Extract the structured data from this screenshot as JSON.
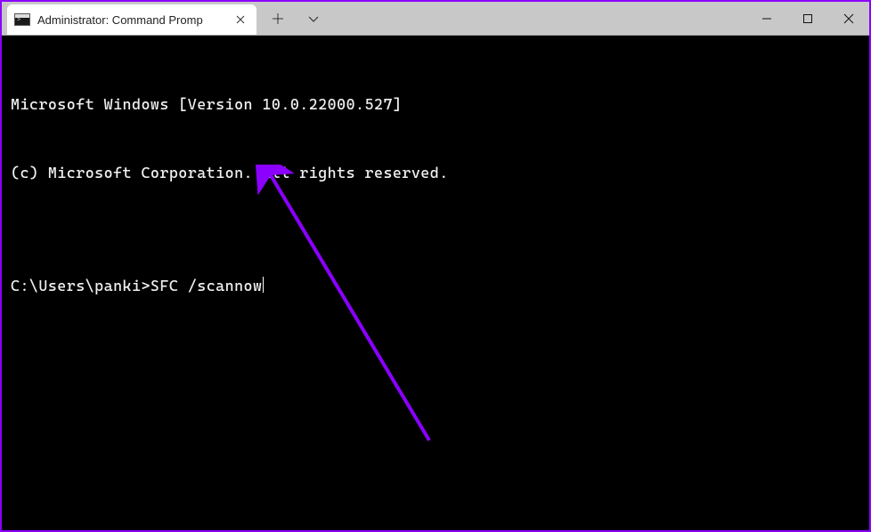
{
  "tab": {
    "title": "Administrator: Command Promp"
  },
  "terminal": {
    "line1": "Microsoft Windows [Version 10.0.22000.527]",
    "line2": "(c) Microsoft Corporation. All rights reserved.",
    "blank": "",
    "prompt": "C:\\Users\\panki>",
    "command": "SFC /scannow"
  }
}
